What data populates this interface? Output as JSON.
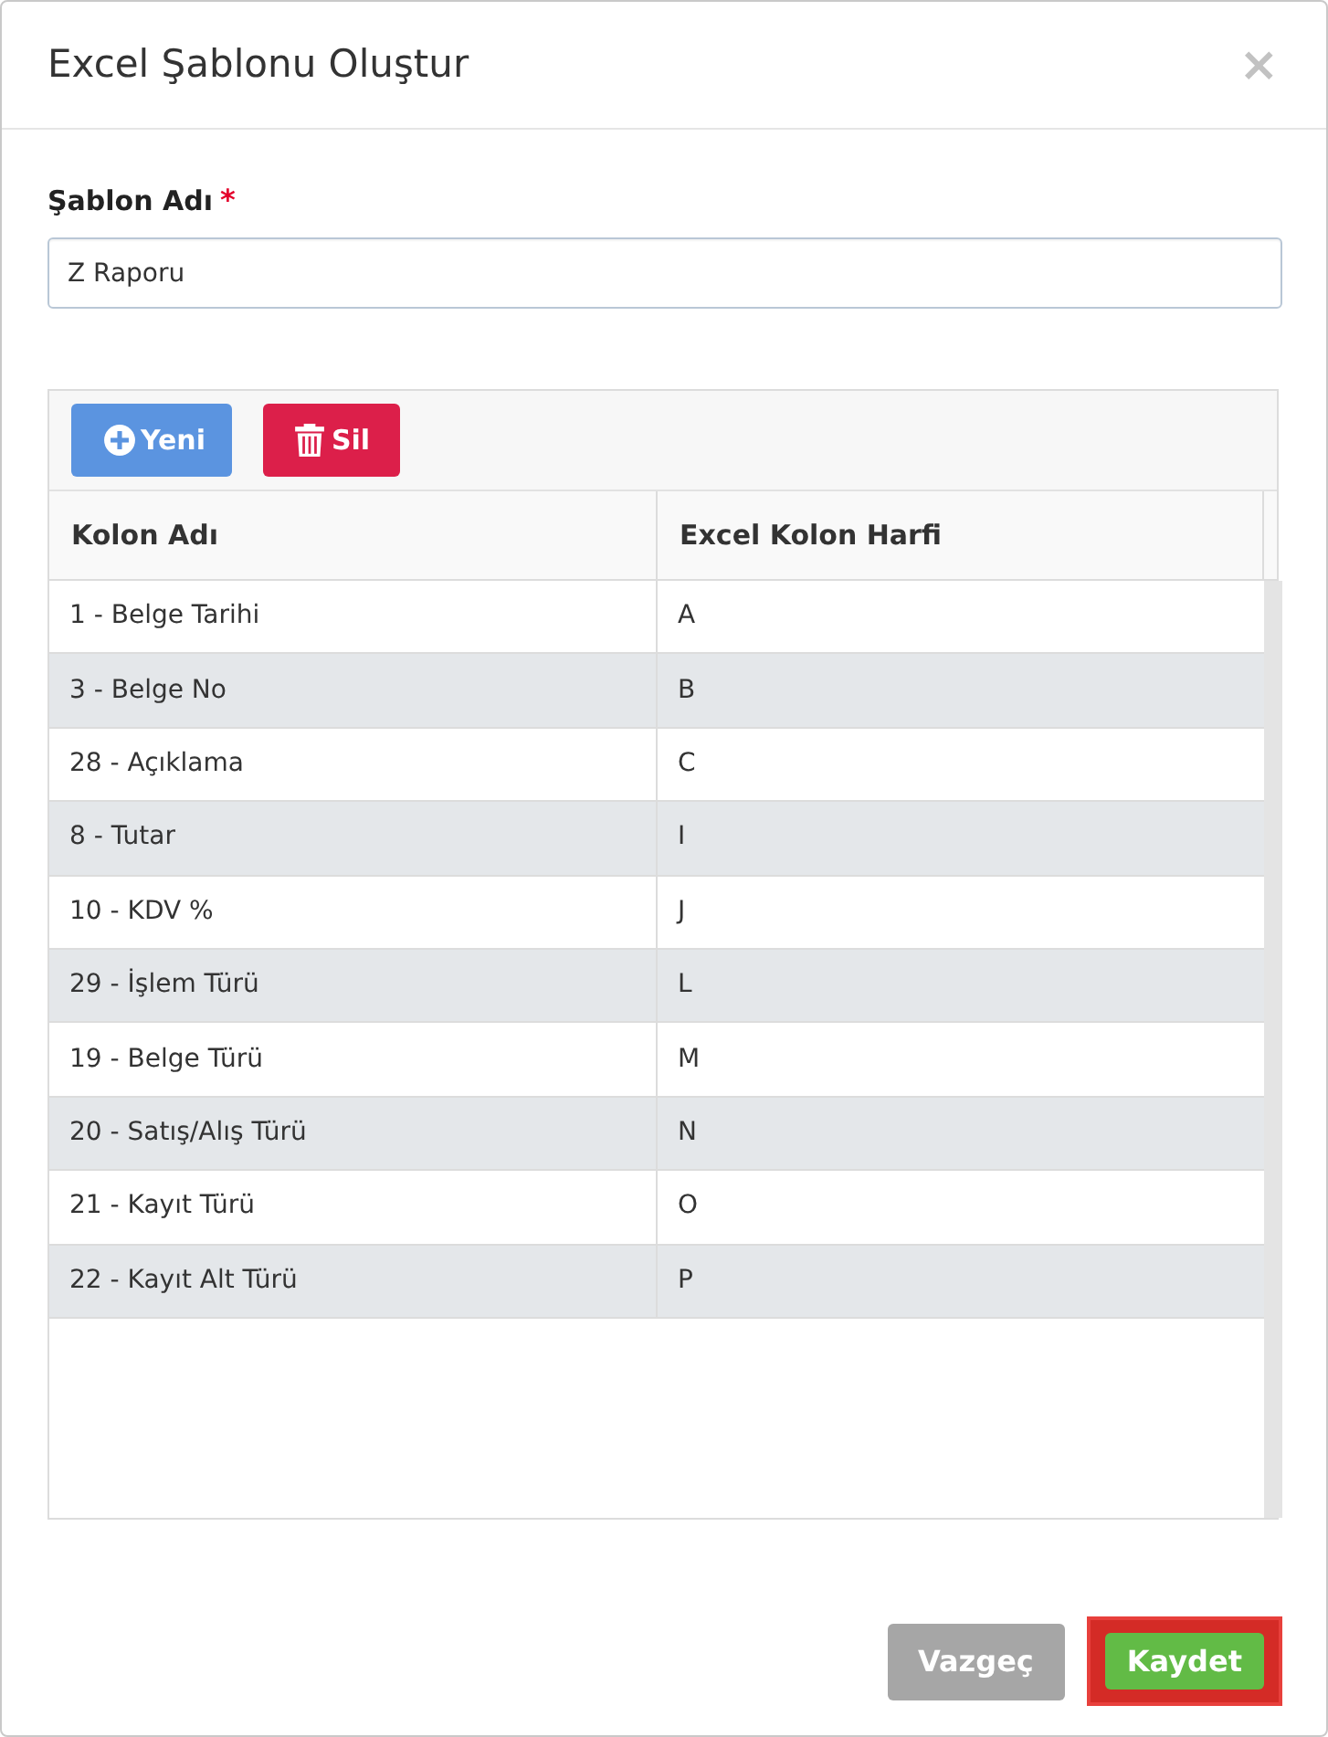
{
  "dialog": {
    "title": "Excel Şablonu Oluştur",
    "close": "×"
  },
  "form": {
    "label": "Şablon Adı",
    "required_mark": "*",
    "value": "Z Raporu"
  },
  "toolbar": [
    {
      "kind": "add",
      "label": "Yeni"
    },
    {
      "kind": "delete",
      "label": "Sil"
    }
  ],
  "table": {
    "columns": [
      "Kolon Adı",
      "Excel Kolon Harfi"
    ],
    "rows": [
      [
        "1 - Belge Tarihi",
        "A"
      ],
      [
        "3 - Belge No",
        "B"
      ],
      [
        "28 - Açıklama",
        "C"
      ],
      [
        "8 - Tutar",
        "I"
      ],
      [
        "10 - KDV %",
        "J"
      ],
      [
        "29 - İşlem Türü",
        "L"
      ],
      [
        "19 - Belge Türü",
        "M"
      ],
      [
        "20 - Satış/Alış Türü",
        "N"
      ],
      [
        "21 - Kayıt Türü",
        "O"
      ],
      [
        "22 - Kayıt Alt Türü",
        "P"
      ]
    ]
  },
  "footer": [
    {
      "kind": "cancel",
      "label": "Vazgeç",
      "highlighted": false
    },
    {
      "kind": "save",
      "label": "Kaydet",
      "highlighted": true
    }
  ]
}
